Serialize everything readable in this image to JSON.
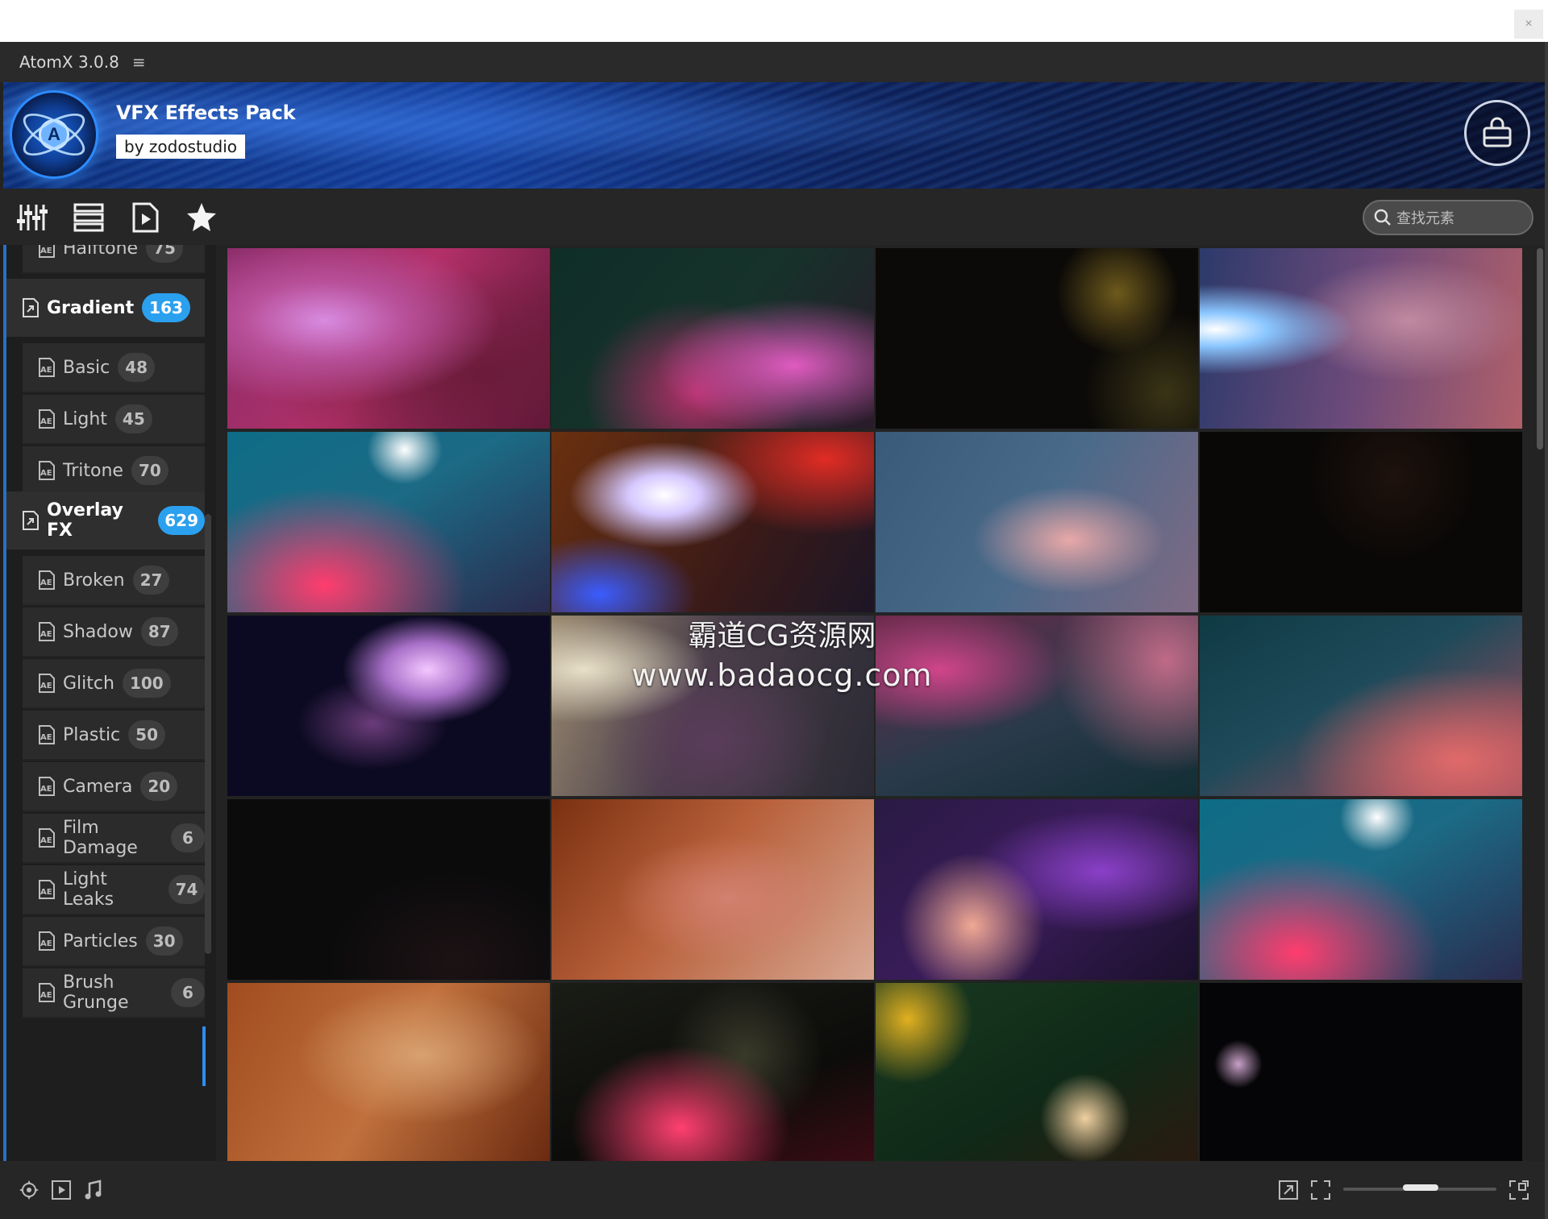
{
  "app": {
    "title": "AtomX 3.0.8",
    "menu_glyph": "≡",
    "close_glyph": "×"
  },
  "banner": {
    "pack_title": "VFX Effects Pack",
    "by_label": "by zodostudio",
    "logo_letter": "A"
  },
  "toolbar": {
    "icons": [
      "sliders-icon",
      "list-icon",
      "video-file-icon",
      "star-icon"
    ],
    "search_placeholder": "查找元素"
  },
  "sidebar": {
    "file_badge_text": "AE",
    "items": [
      {
        "label": "Halftone",
        "count": "75",
        "type": "sub"
      },
      {
        "label": "Gradient",
        "count": "163",
        "type": "category"
      },
      {
        "label": "Basic",
        "count": "48",
        "type": "sub"
      },
      {
        "label": "Light",
        "count": "45",
        "type": "sub"
      },
      {
        "label": "Tritone",
        "count": "70",
        "type": "sub"
      },
      {
        "label": "Overlay FX",
        "count": "629",
        "type": "category"
      },
      {
        "label": "Broken",
        "count": "27",
        "type": "sub"
      },
      {
        "label": "Shadow",
        "count": "87",
        "type": "sub"
      },
      {
        "label": "Glitch",
        "count": "100",
        "type": "sub"
      },
      {
        "label": "Plastic",
        "count": "50",
        "type": "sub"
      },
      {
        "label": "Camera",
        "count": "20",
        "type": "sub"
      },
      {
        "label": "Film Damage",
        "count": "6",
        "type": "sub"
      },
      {
        "label": "Light Leaks",
        "count": "74",
        "type": "sub",
        "active": true
      },
      {
        "label": "Particles",
        "count": "30",
        "type": "sub"
      },
      {
        "label": "Brush Grunge",
        "count": "6",
        "type": "sub"
      }
    ]
  },
  "watermark": {
    "line1": "霸道CG资源网",
    "line2": "www.badaocg.com"
  },
  "statusbar": {
    "left_icons": [
      "gear-target-icon",
      "play-box-icon",
      "music-note-icon"
    ],
    "right_icons": [
      "resize-icon",
      "fit-frame-icon",
      "expand-icon"
    ],
    "zoom_level": 0.45
  },
  "colors": {
    "accent_blue": "#2ba0ef",
    "panel_dark": "#232323"
  }
}
